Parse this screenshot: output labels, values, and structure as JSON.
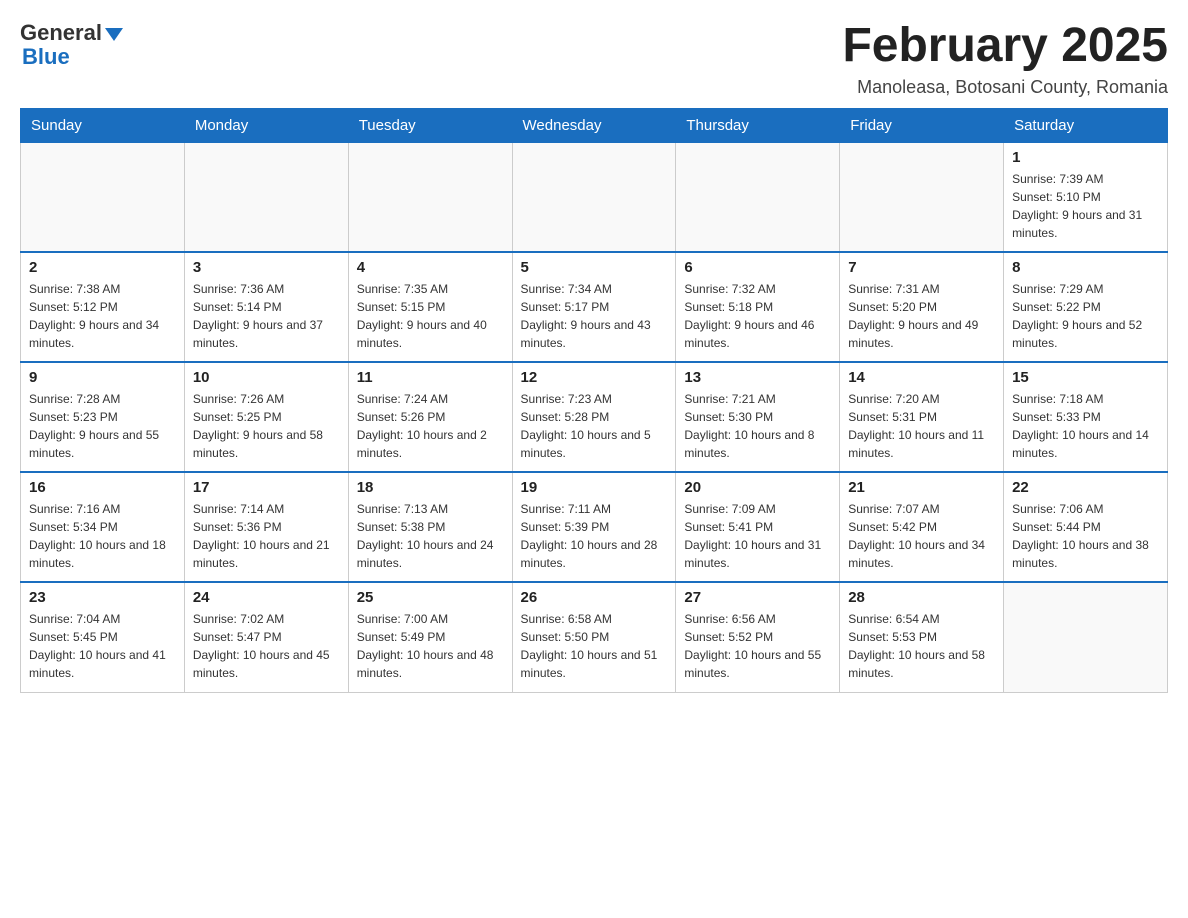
{
  "header": {
    "logo": {
      "general": "General",
      "arrow": "▼",
      "blue": "Blue"
    },
    "title": "February 2025",
    "location": "Manoleasa, Botosani County, Romania"
  },
  "days_of_week": [
    "Sunday",
    "Monday",
    "Tuesday",
    "Wednesday",
    "Thursday",
    "Friday",
    "Saturday"
  ],
  "weeks": [
    {
      "days": [
        {
          "number": "",
          "info": ""
        },
        {
          "number": "",
          "info": ""
        },
        {
          "number": "",
          "info": ""
        },
        {
          "number": "",
          "info": ""
        },
        {
          "number": "",
          "info": ""
        },
        {
          "number": "",
          "info": ""
        },
        {
          "number": "1",
          "info": "Sunrise: 7:39 AM\nSunset: 5:10 PM\nDaylight: 9 hours and 31 minutes."
        }
      ]
    },
    {
      "days": [
        {
          "number": "2",
          "info": "Sunrise: 7:38 AM\nSunset: 5:12 PM\nDaylight: 9 hours and 34 minutes."
        },
        {
          "number": "3",
          "info": "Sunrise: 7:36 AM\nSunset: 5:14 PM\nDaylight: 9 hours and 37 minutes."
        },
        {
          "number": "4",
          "info": "Sunrise: 7:35 AM\nSunset: 5:15 PM\nDaylight: 9 hours and 40 minutes."
        },
        {
          "number": "5",
          "info": "Sunrise: 7:34 AM\nSunset: 5:17 PM\nDaylight: 9 hours and 43 minutes."
        },
        {
          "number": "6",
          "info": "Sunrise: 7:32 AM\nSunset: 5:18 PM\nDaylight: 9 hours and 46 minutes."
        },
        {
          "number": "7",
          "info": "Sunrise: 7:31 AM\nSunset: 5:20 PM\nDaylight: 9 hours and 49 minutes."
        },
        {
          "number": "8",
          "info": "Sunrise: 7:29 AM\nSunset: 5:22 PM\nDaylight: 9 hours and 52 minutes."
        }
      ]
    },
    {
      "days": [
        {
          "number": "9",
          "info": "Sunrise: 7:28 AM\nSunset: 5:23 PM\nDaylight: 9 hours and 55 minutes."
        },
        {
          "number": "10",
          "info": "Sunrise: 7:26 AM\nSunset: 5:25 PM\nDaylight: 9 hours and 58 minutes."
        },
        {
          "number": "11",
          "info": "Sunrise: 7:24 AM\nSunset: 5:26 PM\nDaylight: 10 hours and 2 minutes."
        },
        {
          "number": "12",
          "info": "Sunrise: 7:23 AM\nSunset: 5:28 PM\nDaylight: 10 hours and 5 minutes."
        },
        {
          "number": "13",
          "info": "Sunrise: 7:21 AM\nSunset: 5:30 PM\nDaylight: 10 hours and 8 minutes."
        },
        {
          "number": "14",
          "info": "Sunrise: 7:20 AM\nSunset: 5:31 PM\nDaylight: 10 hours and 11 minutes."
        },
        {
          "number": "15",
          "info": "Sunrise: 7:18 AM\nSunset: 5:33 PM\nDaylight: 10 hours and 14 minutes."
        }
      ]
    },
    {
      "days": [
        {
          "number": "16",
          "info": "Sunrise: 7:16 AM\nSunset: 5:34 PM\nDaylight: 10 hours and 18 minutes."
        },
        {
          "number": "17",
          "info": "Sunrise: 7:14 AM\nSunset: 5:36 PM\nDaylight: 10 hours and 21 minutes."
        },
        {
          "number": "18",
          "info": "Sunrise: 7:13 AM\nSunset: 5:38 PM\nDaylight: 10 hours and 24 minutes."
        },
        {
          "number": "19",
          "info": "Sunrise: 7:11 AM\nSunset: 5:39 PM\nDaylight: 10 hours and 28 minutes."
        },
        {
          "number": "20",
          "info": "Sunrise: 7:09 AM\nSunset: 5:41 PM\nDaylight: 10 hours and 31 minutes."
        },
        {
          "number": "21",
          "info": "Sunrise: 7:07 AM\nSunset: 5:42 PM\nDaylight: 10 hours and 34 minutes."
        },
        {
          "number": "22",
          "info": "Sunrise: 7:06 AM\nSunset: 5:44 PM\nDaylight: 10 hours and 38 minutes."
        }
      ]
    },
    {
      "days": [
        {
          "number": "23",
          "info": "Sunrise: 7:04 AM\nSunset: 5:45 PM\nDaylight: 10 hours and 41 minutes."
        },
        {
          "number": "24",
          "info": "Sunrise: 7:02 AM\nSunset: 5:47 PM\nDaylight: 10 hours and 45 minutes."
        },
        {
          "number": "25",
          "info": "Sunrise: 7:00 AM\nSunset: 5:49 PM\nDaylight: 10 hours and 48 minutes."
        },
        {
          "number": "26",
          "info": "Sunrise: 6:58 AM\nSunset: 5:50 PM\nDaylight: 10 hours and 51 minutes."
        },
        {
          "number": "27",
          "info": "Sunrise: 6:56 AM\nSunset: 5:52 PM\nDaylight: 10 hours and 55 minutes."
        },
        {
          "number": "28",
          "info": "Sunrise: 6:54 AM\nSunset: 5:53 PM\nDaylight: 10 hours and 58 minutes."
        },
        {
          "number": "",
          "info": ""
        }
      ]
    }
  ]
}
